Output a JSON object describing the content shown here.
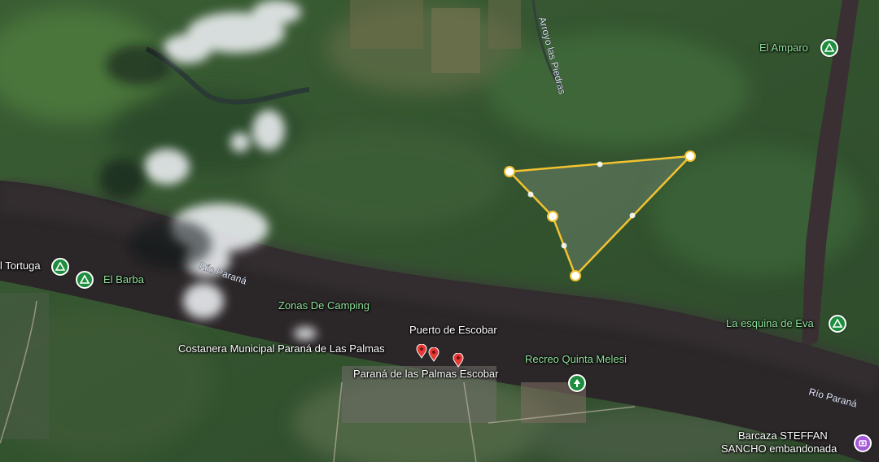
{
  "map": {
    "place_labels": {
      "el_amparo": "El Amparo",
      "tortuga": "l Tortuga",
      "el_barba": "El Barba",
      "zonas_camping": "Zonas De Camping",
      "puerto_escobar": "Puerto de Escobar",
      "costanera": "Costanera Municipal Paraná de Las Palmas",
      "parana_palmas_escobar": "Paraná de las Palmas Escobar",
      "recreo_quinta": "Recreo Quinta Melesi",
      "esquina_eva": "La esquina de Eva",
      "barcaza_line1": "Barcaza STEFFAN",
      "barcaza_line2": "SANCHO embandonada"
    },
    "water_labels": {
      "arroyo": "Arroyo las Piedras",
      "rio_parana_1": "Río Paraná",
      "rio_parana_2": "Río Paraná"
    },
    "icons": {
      "camp": "campground-icon",
      "park": "tree-park-icon",
      "pin": "map-pin-icon",
      "landmark": "landmark-icon"
    },
    "colors": {
      "polygon_stroke": "#f2c330",
      "camp_green": "#1e8e3e",
      "pin_red": "#e53935",
      "landmark_purple": "#a45ad6"
    }
  }
}
